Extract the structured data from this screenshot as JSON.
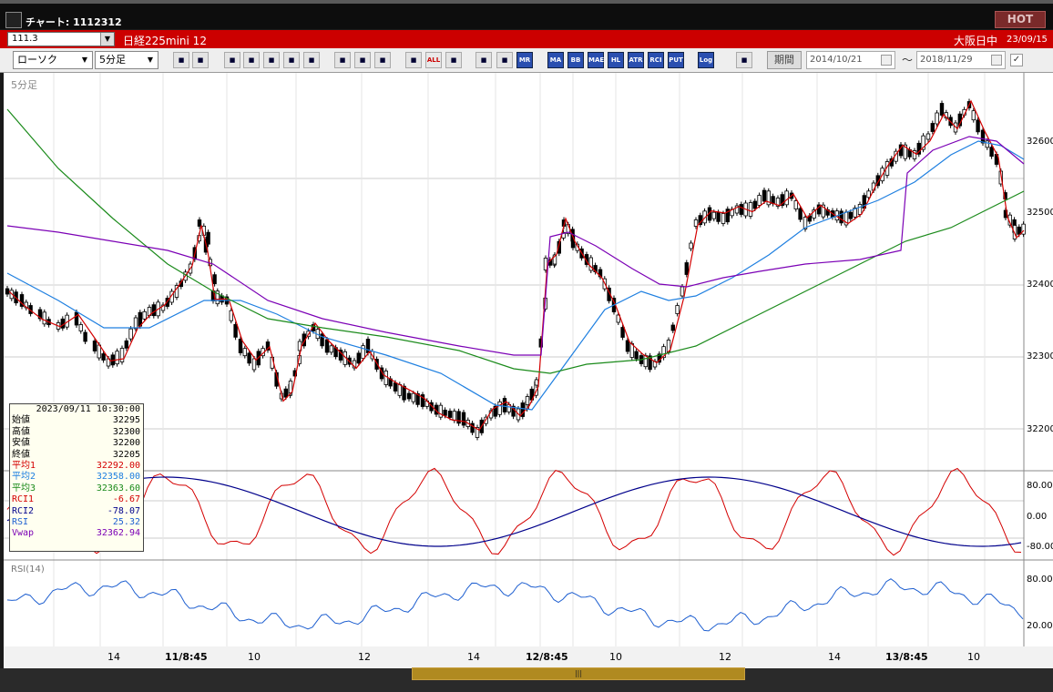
{
  "window": {
    "title": "チャート: 1112312",
    "hot_label": "HOT"
  },
  "infobar": {
    "symbol": "111.3",
    "instrument": "日経225mini 12",
    "exchange": "大阪日中",
    "date": "23/09/15"
  },
  "toolbar": {
    "chart_type": "ローソク",
    "timeframe": "5分足",
    "buttons": [
      "zoom-icon",
      "crosshair-icon",
      "trend-icon",
      "ruler-icon",
      "bar-icon",
      "blank-icon",
      "pen-icon",
      "cursor-icon",
      "eraser-icon",
      "candle-icon",
      "box-icon",
      "ALL",
      "hammer-icon",
      "paint-icon",
      "palette-icon",
      "MR",
      "MA",
      "BB",
      "MAE",
      "HL",
      "ATR",
      "RCI",
      "PUT",
      "Log",
      "copy-icon"
    ],
    "period_label": "期間",
    "date_from": "2014/10/21",
    "date_to": "2018/11/29",
    "tilde": "〜",
    "check": "✓"
  },
  "chart": {
    "timeframe_label": "5分足",
    "rsi_label": "RSI(14)",
    "price_labels": [
      "32600",
      "32500",
      "32400",
      "32300",
      "32200"
    ],
    "osc_labels": [
      "80.00",
      "0.00",
      "-80.00"
    ],
    "rsi_labels": [
      "80.00",
      "20.00"
    ],
    "x_labels": [
      "14",
      "11/8:45",
      "10",
      "12",
      "14",
      "12/8:45",
      "10",
      "12",
      "14",
      "13/8:45",
      "10"
    ],
    "colors": {
      "ma1": "#d40000",
      "ma2": "#1e7fe0",
      "ma3": "#1a8a1a",
      "vwap": "#7b00b5",
      "rci1": "#d40000",
      "rci2": "#00008b",
      "rsi": "#1e5fd0"
    }
  },
  "databox": {
    "header": "2023/09/11  10:30:00",
    "rows": [
      {
        "k": "始値",
        "v": "32295",
        "c": "#000"
      },
      {
        "k": "高値",
        "v": "32300",
        "c": "#000"
      },
      {
        "k": "安値",
        "v": "32200",
        "c": "#000"
      },
      {
        "k": "終値",
        "v": "32205",
        "c": "#000"
      },
      {
        "k": "平均1",
        "v": "32292.00",
        "c": "#d40000"
      },
      {
        "k": "平均2",
        "v": "32358.00",
        "c": "#1e7fe0"
      },
      {
        "k": "平均3",
        "v": "32363.60",
        "c": "#1a8a1a"
      },
      {
        "k": "RCI1",
        "v": "-6.67",
        "c": "#d40000"
      },
      {
        "k": "RCI2",
        "v": "-78.07",
        "c": "#00008b"
      },
      {
        "k": "RSI",
        "v": "25.32",
        "c": "#1e5fd0"
      },
      {
        "k": "Vwap",
        "v": "32362.94",
        "c": "#7b00b5"
      }
    ]
  },
  "scroll": {
    "thumb": "|||"
  }
}
